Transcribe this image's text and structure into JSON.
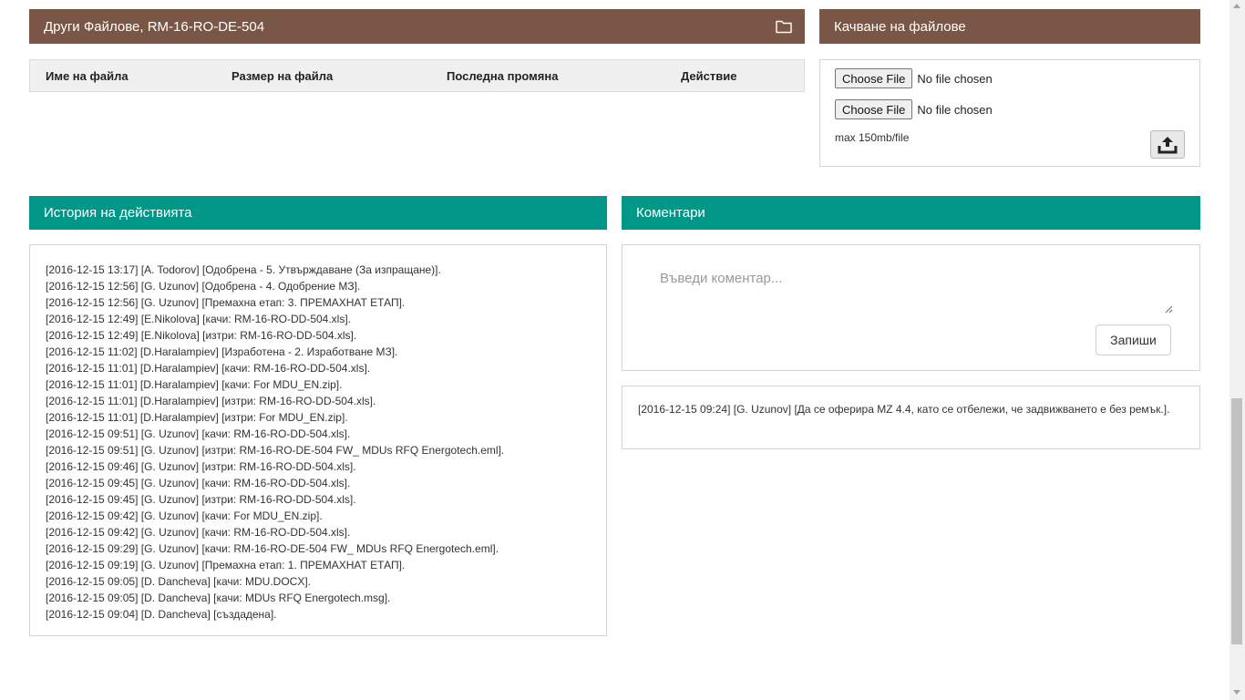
{
  "files_panel": {
    "title": "Други Файлове, RM-16-RO-DE-504",
    "icon": "folder-icon",
    "columns": [
      "Име на файла",
      "Размер на файла",
      "Последна промяна",
      "Действие"
    ]
  },
  "upload_panel": {
    "title": "Качване на файлове",
    "inputs": [
      {
        "button_label": "Choose File",
        "status": "No file chosen"
      },
      {
        "button_label": "Choose File",
        "status": "No file chosen"
      }
    ],
    "max_size": "max 150mb/file",
    "upload_icon": "upload-icon"
  },
  "history_panel": {
    "title": "История на действията",
    "entries": [
      "[2016-12-15 13:17] [A. Todorov] [Одобрена - 5. Утвърждаване (За изпращане)].",
      "[2016-12-15 12:56] [G. Uzunov] [Одобрена - 4. Одобрение МЗ].",
      "[2016-12-15 12:56] [G. Uzunov] [Премахна етап: 3. ПРЕМАХНАТ ЕТАП].",
      "[2016-12-15 12:49] [E.Nikolova] [качи: RM-16-RO-DD-504.xls].",
      "[2016-12-15 12:49] [E.Nikolova] [изтри: RM-16-RO-DD-504.xls].",
      "[2016-12-15 11:02] [D.Haralampiev] [Изработена - 2. Изработване МЗ].",
      "[2016-12-15 11:01] [D.Haralampiev] [качи: RM-16-RO-DD-504.xls].",
      "[2016-12-15 11:01] [D.Haralampiev] [качи: For MDU_EN.zip].",
      "[2016-12-15 11:01] [D.Haralampiev] [изтри: RM-16-RO-DD-504.xls].",
      "[2016-12-15 11:01] [D.Haralampiev] [изтри: For MDU_EN.zip].",
      "[2016-12-15 09:51] [G. Uzunov] [качи: RM-16-RO-DD-504.xls].",
      "[2016-12-15 09:51] [G. Uzunov] [изтри: RM-16-RO-DE-504 FW_ MDUs RFQ Energotech.eml].",
      "[2016-12-15 09:46] [G. Uzunov] [изтри: RM-16-RO-DD-504.xls].",
      "[2016-12-15 09:45] [G. Uzunov] [качи: RM-16-RO-DD-504.xls].",
      "[2016-12-15 09:45] [G. Uzunov] [изтри: RM-16-RO-DD-504.xls].",
      "[2016-12-15 09:42] [G. Uzunov] [качи: For MDU_EN.zip].",
      "[2016-12-15 09:42] [G. Uzunov] [качи: RM-16-RO-DD-504.xls].",
      "[2016-12-15 09:29] [G. Uzunov] [качи: RM-16-RO-DE-504 FW_ MDUs RFQ Energotech.eml].",
      "[2016-12-15 09:19] [G. Uzunov] [Премахна етап: 1. ПРЕМАХНАТ ЕТАП].",
      "[2016-12-15 09:05] [D. Dancheva] [качи: MDU.DOCX].",
      "[2016-12-15 09:05] [D. Dancheva] [качи: MDUs RFQ Energotech.msg].",
      "[2016-12-15 09:04] [D. Dancheva] [създадена]."
    ]
  },
  "comments_panel": {
    "title": "Коментари",
    "placeholder": "Въведи коментар...",
    "save_label": "Запиши",
    "comments": [
      "[2016-12-15 09:24] [G. Uzunov] [Да се оферира MZ 4.4, като се отбележи, че задвижването е без ремък.]."
    ]
  },
  "colors": {
    "brown_header": "#7a5646",
    "teal_header": "#009688"
  }
}
